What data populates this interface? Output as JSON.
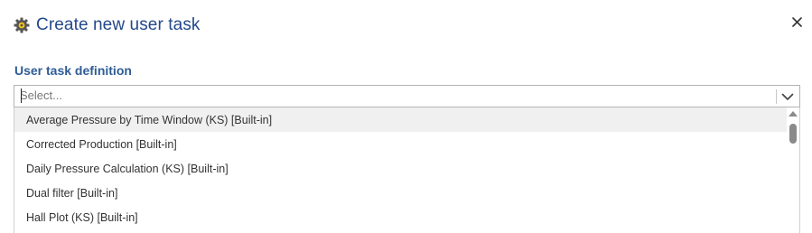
{
  "dialog": {
    "title": "Create new user task",
    "header_icon": "gear-icon",
    "close_icon": "close-icon"
  },
  "field": {
    "label": "User task definition",
    "placeholder": "Select...",
    "chevron_icon": "chevron-down-icon"
  },
  "options": [
    "Average Pressure by Time Window (KS) [Built-in]",
    "Corrected Production [Built-in]",
    "Daily Pressure Calculation (KS) [Built-in]",
    "Dual filter [Built-in]",
    "Hall Plot (KS) [Built-in]"
  ],
  "colors": {
    "title": "#24498a",
    "label": "#2f5c95"
  }
}
